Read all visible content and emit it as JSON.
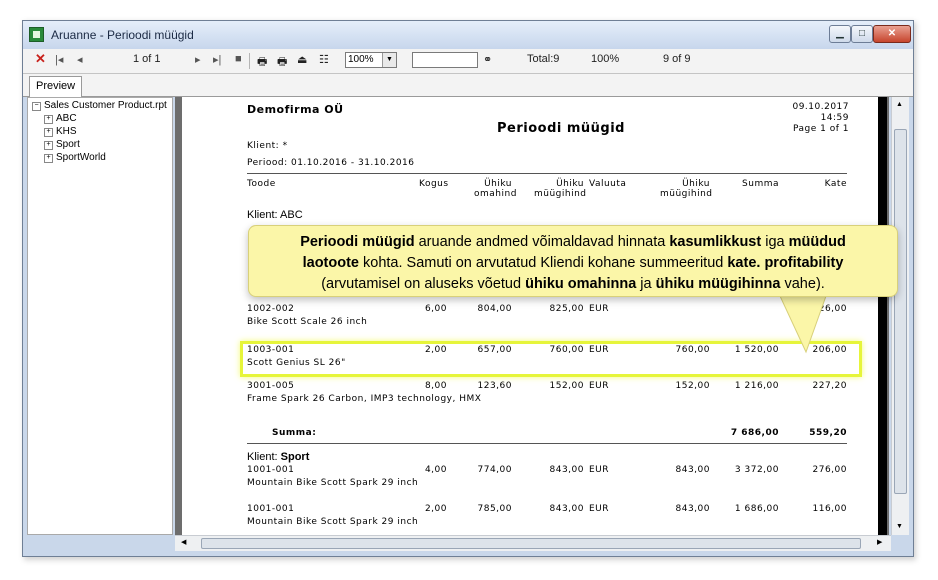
{
  "window": {
    "title": "Aruanne - Perioodi müügid"
  },
  "toolbar": {
    "close_glyph": "✕",
    "page_of": "1 of 1",
    "zoom": "100%",
    "total": "Total:9",
    "percent": "100%",
    "count_of": "9 of 9"
  },
  "tabs": {
    "preview": "Preview"
  },
  "tree": {
    "root": "Sales Customer Product.rpt",
    "items": [
      "ABC",
      "KHS",
      "Sport",
      "SportWorld"
    ]
  },
  "report": {
    "company": "Demofirma OÜ",
    "date": "09.10.2017",
    "time": "14:59",
    "page": "Page 1 of 1",
    "title": "Perioodi müügid",
    "client_filter": "Klient: *",
    "period": "Periood: 01.10.2016 - 31.10.2016",
    "columns": {
      "product": "Toode",
      "qty": "Kogus",
      "unit_cost": "Ühiku\nomahind",
      "unit_price": "Ühiku\nmüügihind",
      "currency": "Valuuta",
      "unit_price2": "Ühiku\nmüügihind",
      "sum": "Summa",
      "margin": "Kate"
    },
    "group_abc": "Klient: ABC",
    "abc_rows": [
      {
        "code": "1002-002",
        "name": "Bike Scott Scale 26 inch",
        "qty": "6,00",
        "cost": "804,00",
        "price": "825,00",
        "cur": "EUR",
        "price2": "",
        "sum": "",
        "margin": "126,00"
      },
      {
        "code": "1003-001",
        "name": "Scott Genius SL 26\"",
        "qty": "2,00",
        "cost": "657,00",
        "price": "760,00",
        "cur": "EUR",
        "price2": "760,00",
        "sum": "1 520,00",
        "margin": "206,00"
      },
      {
        "code": "3001-005",
        "name": "Frame Spark 26 Carbon, IMP3 technology, HMX",
        "qty": "8,00",
        "cost": "123,60",
        "price": "152,00",
        "cur": "EUR",
        "price2": "152,00",
        "sum": "1 216,00",
        "margin": "227,20"
      }
    ],
    "summa_label": "Summa:",
    "summa_sum": "7 686,00",
    "summa_margin": "559,20",
    "group_sport_prefix": "Klient: ",
    "group_sport_name": "Sport",
    "sport_rows": [
      {
        "code": "1001-001",
        "name": "Mountain Bike Scott Spark 29 inch",
        "qty": "4,00",
        "cost": "774,00",
        "price": "843,00",
        "cur": "EUR",
        "price2": "843,00",
        "sum": "3 372,00",
        "margin": "276,00"
      },
      {
        "code": "1001-001",
        "name": "Mountain Bike Scott Spark 29 inch",
        "qty": "2,00",
        "cost": "785,00",
        "price": "843,00",
        "cur": "EUR",
        "price2": "843,00",
        "sum": "1 686,00",
        "margin": "116,00"
      }
    ]
  },
  "callout": {
    "l1_b1": "Perioodi müügid",
    "l1_t1": " aruande andmed võimaldavad hinnata ",
    "l1_b2": "kasumlikkust",
    "l1_t2": " iga ",
    "l1_b3": "müüdud",
    "l2_b1": "laotoote",
    "l2_t1": " kohta.  Samuti on arvutatud Kliendi kohane summeeritud ",
    "l2_b2": "kate. profitability",
    "l3_t1": "(arvutamisel on aluseks võetud ",
    "l3_b1": "ühiku omahinna",
    "l3_t2": " ja ",
    "l3_b2": "ühiku müügihinna",
    "l3_t3": " vahe)."
  },
  "colors": {
    "highlight": "#e6f53a",
    "callout": "#fbf6a8"
  }
}
